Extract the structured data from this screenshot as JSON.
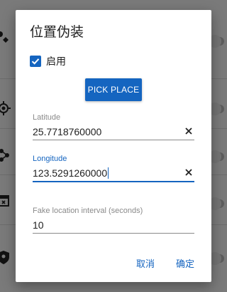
{
  "background": {
    "icons": [
      "wrench-icon",
      "crosshair-icon",
      "share-nodes-icon",
      "calendar-icon",
      "shield-icon"
    ]
  },
  "dialog": {
    "title": "位置伪装",
    "enable": {
      "label": "启用",
      "checked": true
    },
    "pick_place_label": "PICK PLACE",
    "latitude": {
      "label": "Latitude",
      "value": "25.7718760000"
    },
    "longitude": {
      "label": "Longitude",
      "value": "123.5291260000"
    },
    "interval": {
      "label": "Fake location interval (seconds)",
      "value": "10"
    },
    "cancel_label": "取消",
    "confirm_label": "确定"
  },
  "colors": {
    "accent": "#1565c0",
    "scrim": "#7a7a7a"
  }
}
